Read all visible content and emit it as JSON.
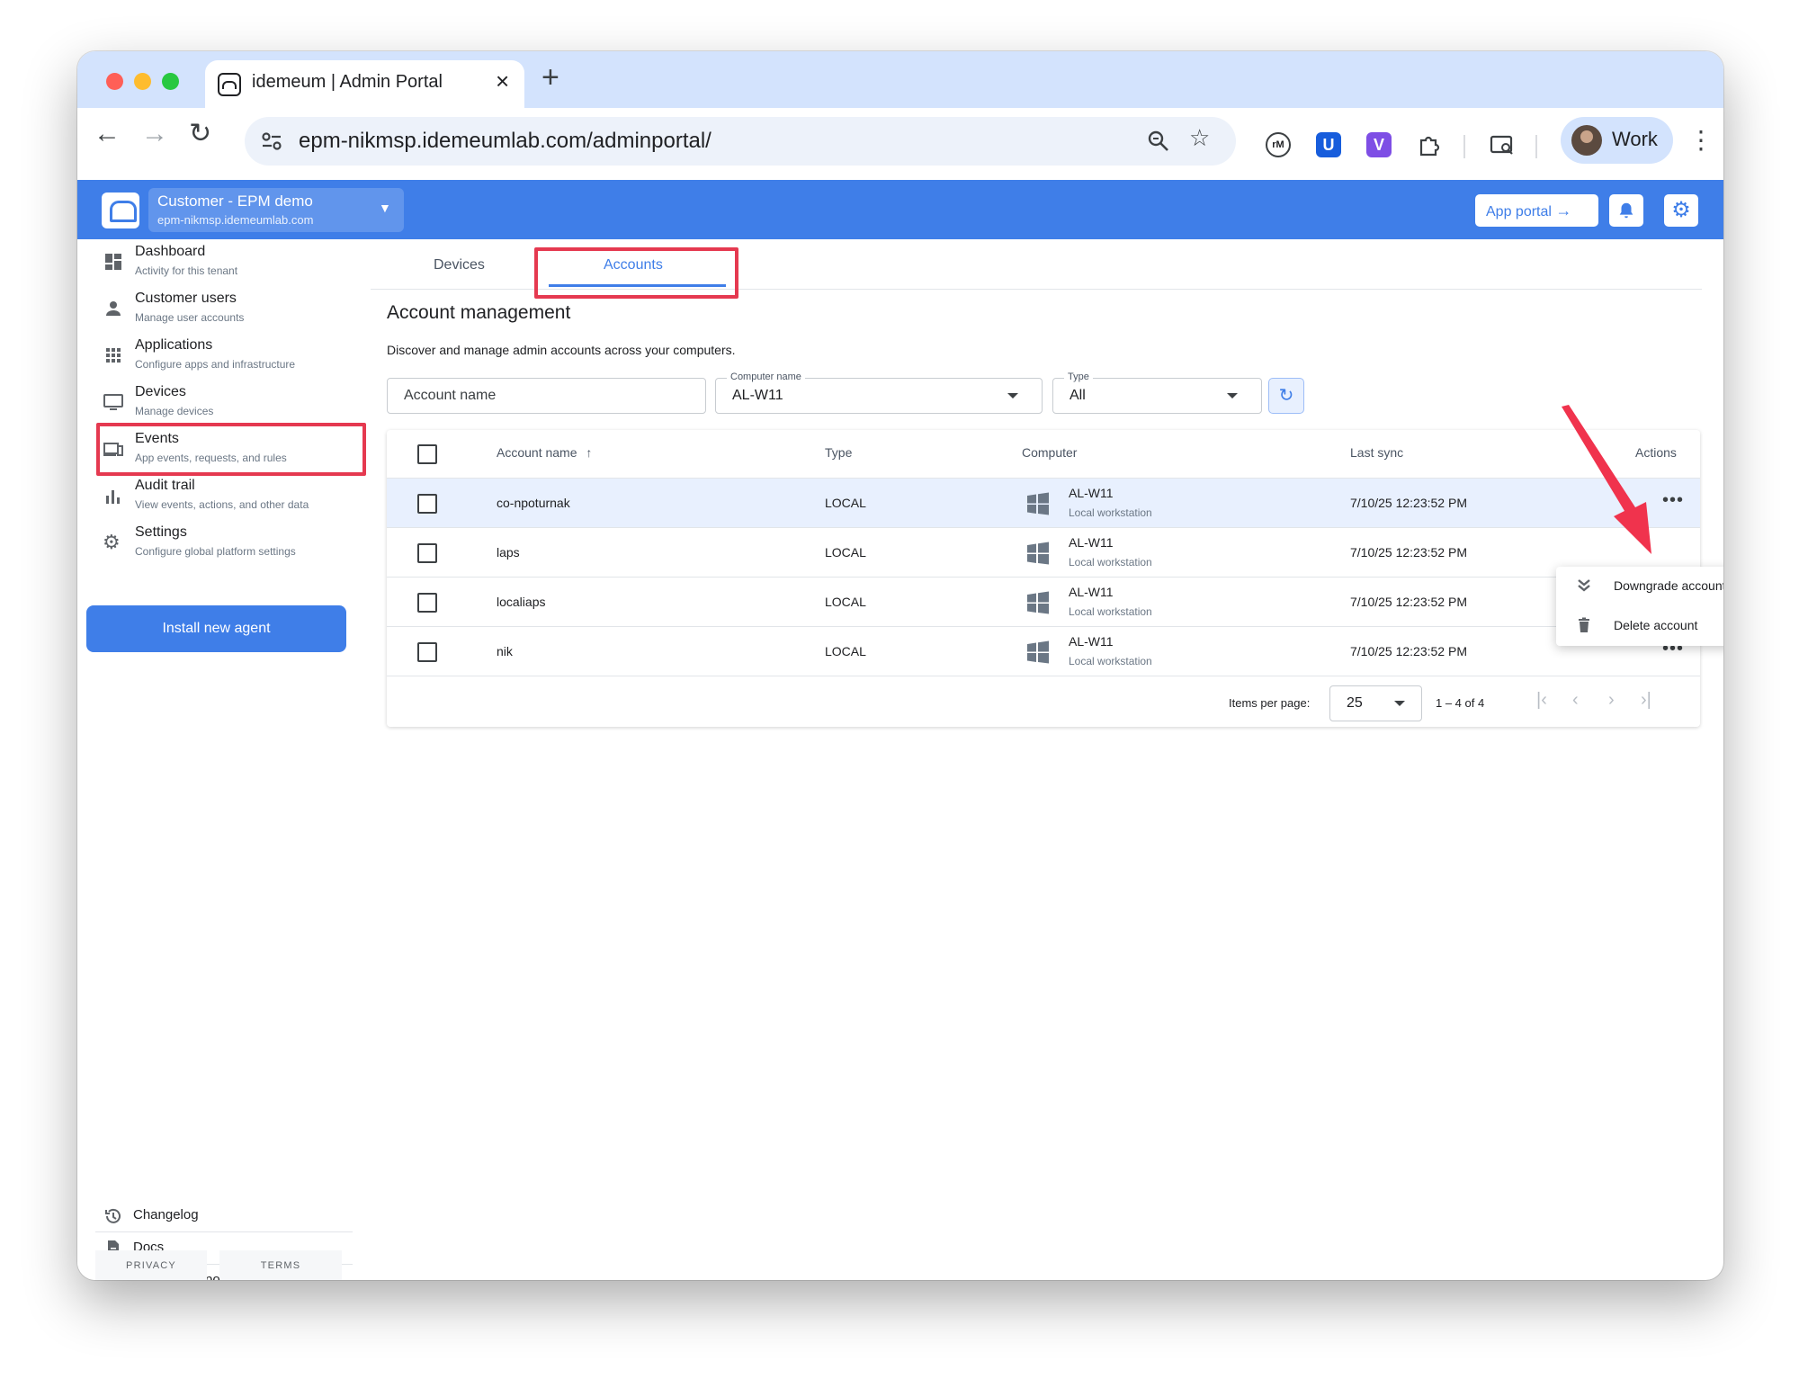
{
  "browser": {
    "tab_title": "idemeum | Admin Portal",
    "url": "epm-nikmsp.idemeumlab.com/adminportal/",
    "profile_label": "Work"
  },
  "header": {
    "tenant_name": "Customer - EPM demo",
    "tenant_url": "epm-nikmsp.idemeumlab.com",
    "app_portal_label": "App portal"
  },
  "sidebar": {
    "items": [
      {
        "title": "Dashboard",
        "subtitle": "Activity for this tenant"
      },
      {
        "title": "Customer users",
        "subtitle": "Manage user accounts"
      },
      {
        "title": "Applications",
        "subtitle": "Configure apps and infrastructure"
      },
      {
        "title": "Devices",
        "subtitle": "Manage devices"
      },
      {
        "title": "Events",
        "subtitle": "App events, requests, and rules"
      },
      {
        "title": "Audit trail",
        "subtitle": "View events, actions, and other data"
      },
      {
        "title": "Settings",
        "subtitle": "Configure global platform settings"
      }
    ],
    "install_button": "Install new agent",
    "footer_links": [
      "Changelog",
      "Docs",
      "Contact support"
    ],
    "privacy": "PRIVACY",
    "terms": "TERMS"
  },
  "main": {
    "tabs": [
      "Devices",
      "Accounts"
    ],
    "active_tab": "Accounts",
    "title": "Account management",
    "description": "Discover and manage admin accounts across your computers.",
    "filters": {
      "account_placeholder": "Account name",
      "computer_label": "Computer name",
      "computer_value": "AL-W11",
      "type_label": "Type",
      "type_value": "All"
    },
    "table": {
      "columns": [
        "Account name",
        "Type",
        "Computer",
        "Last sync",
        "Actions"
      ],
      "rows": [
        {
          "account": "co-npoturnak",
          "type": "LOCAL",
          "computer": "AL-W11",
          "computer_sub": "Local workstation",
          "last_sync": "7/10/25 12:23:52 PM"
        },
        {
          "account": "laps",
          "type": "LOCAL",
          "computer": "AL-W11",
          "computer_sub": "Local workstation",
          "last_sync": "7/10/25 12:23:52 PM"
        },
        {
          "account": "localiaps",
          "type": "LOCAL",
          "computer": "AL-W11",
          "computer_sub": "Local workstation",
          "last_sync": "7/10/25 12:23:52 PM"
        },
        {
          "account": "nik",
          "type": "LOCAL",
          "computer": "AL-W11",
          "computer_sub": "Local workstation",
          "last_sync": "7/10/25 12:23:52 PM"
        }
      ]
    },
    "pagination": {
      "items_per_page_label": "Items per page:",
      "items_per_page": "25",
      "range": "1 – 4 of 4"
    },
    "row_menu": [
      "Downgrade account",
      "Delete account"
    ]
  },
  "colors": {
    "accent": "#3f7ee8",
    "highlight": "#e53950",
    "selected_row": "#e8f0fe"
  }
}
